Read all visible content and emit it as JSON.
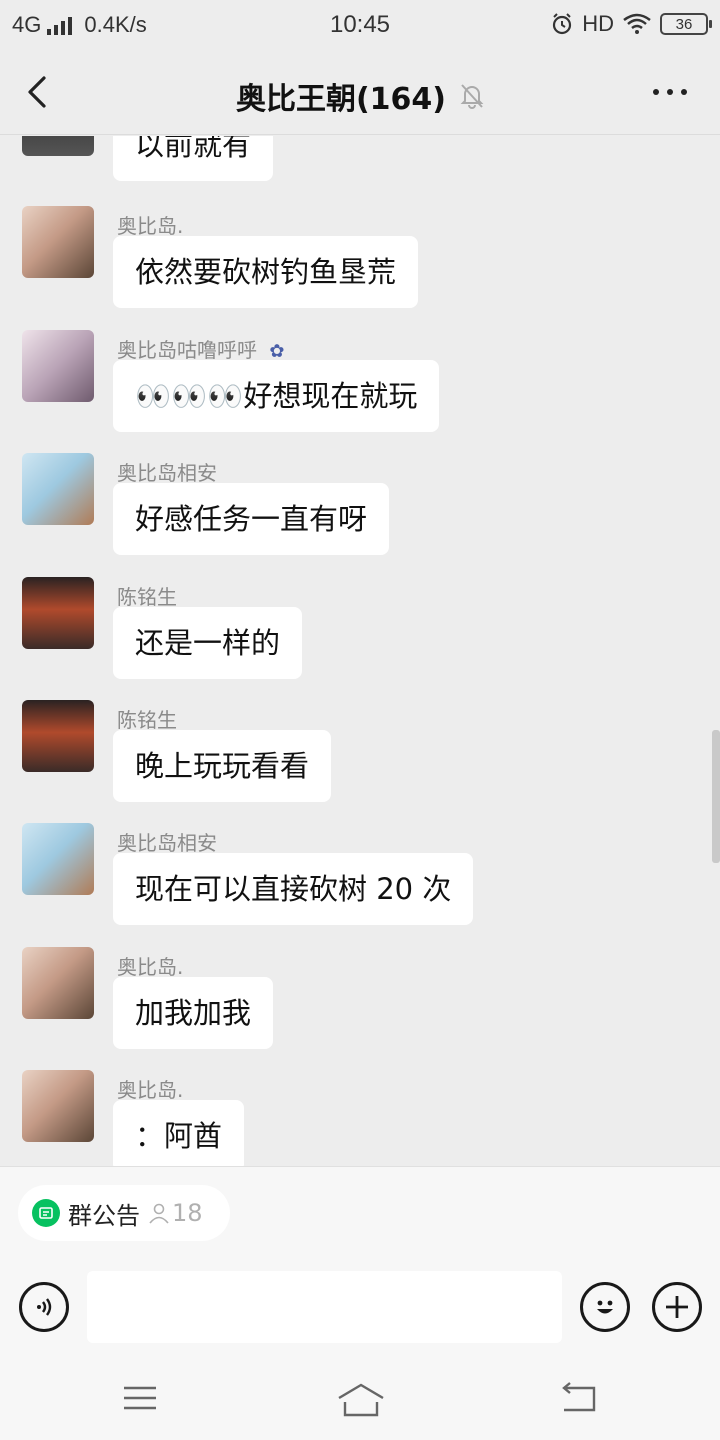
{
  "status_bar": {
    "network": "4G",
    "speed": "0.4K/s",
    "time": "10:45",
    "hd": "HD",
    "battery": "36"
  },
  "header": {
    "title": "奥比王朝(164)",
    "mute_icon": "bell-muted-icon",
    "back_icon": "chevron-left-icon",
    "more_icon": "more-dots-icon"
  },
  "messages": [
    {
      "sender": "",
      "text": "以前就有"
    },
    {
      "sender": "奥比岛.",
      "text": "依然要砍树钓鱼垦荒"
    },
    {
      "sender": "奥比岛咕噜呼呼",
      "text": "👀👀👀好想现在就玩"
    },
    {
      "sender": "奥比岛相安",
      "text": "好感任务一直有呀"
    },
    {
      "sender": "陈铭生",
      "text": "还是一样的"
    },
    {
      "sender": "陈铭生",
      "text": "晚上玩玩看看"
    },
    {
      "sender": "奥比岛相安",
      "text": "现在可以直接砍树 20 次"
    },
    {
      "sender": "奥比岛.",
      "text": "加我加我"
    },
    {
      "sender": "奥比岛.",
      "text": "：阿酋"
    }
  ],
  "bottom": {
    "notice_label": "群公告",
    "notice_count": "18",
    "input_placeholder": ""
  },
  "colors": {
    "background": "#ededed",
    "bubble": "#ffffff",
    "accent": "#07c160"
  }
}
